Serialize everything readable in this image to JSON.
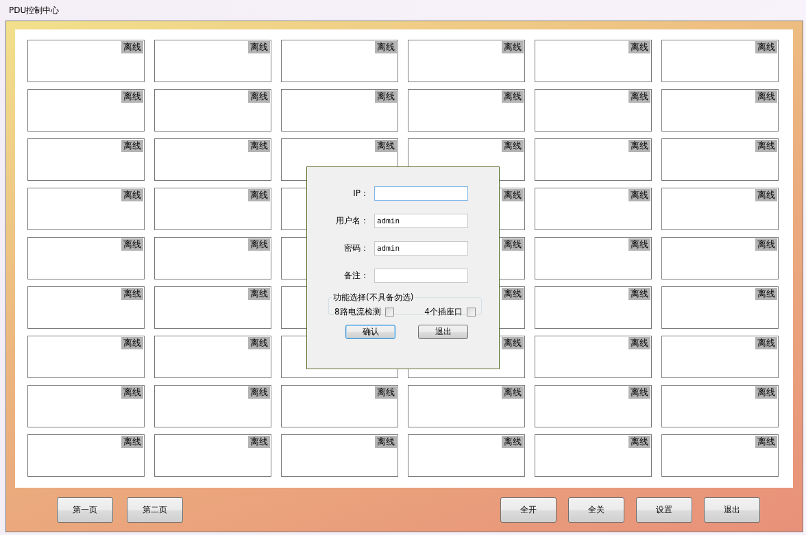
{
  "window": {
    "title": "PDU控制中心"
  },
  "grid": {
    "rows": [
      {
        "cells": [
          "离线",
          "离线",
          "离线",
          "离线",
          "离线",
          "离线"
        ]
      },
      {
        "cells": [
          "离线",
          "离线",
          "离线",
          "离线",
          "离线",
          "离线"
        ]
      },
      {
        "cells": [
          "离线",
          "离线",
          "离线",
          "离线",
          "离线",
          "离线"
        ]
      },
      {
        "cells": [
          "离线",
          "离线",
          null,
          "离线",
          "离线",
          "离线"
        ]
      },
      {
        "cells": [
          "离线",
          "离线",
          null,
          "离线",
          "离线",
          "离线"
        ]
      },
      {
        "cells": [
          "离线",
          "离线",
          null,
          "离线",
          "离线",
          "离线"
        ]
      },
      {
        "cells": [
          "离线",
          "离线",
          null,
          "离线",
          "离线",
          "离线"
        ]
      },
      {
        "cells": [
          "离线",
          "离线",
          "离线",
          "离线",
          "离线",
          "离线"
        ]
      },
      {
        "cells": [
          "离线",
          "离线",
          "离线",
          "离线",
          "离线",
          "离线"
        ]
      }
    ]
  },
  "dialog": {
    "fields": [
      {
        "label": "IP：",
        "focused": true
      },
      {
        "label": "用户名：",
        "value": "admin",
        "focused": false
      },
      {
        "label": "密码：",
        "value": "admin",
        "focused": false
      },
      {
        "label": "备注：",
        "focused": false
      }
    ],
    "group": {
      "title": "功能选择(不具备勿选)",
      "options": [
        {
          "label": "8路电流检测",
          "checked": false
        },
        {
          "label": "4个插座口",
          "checked": false
        }
      ]
    },
    "buttons": [
      {
        "label": "确认",
        "default": true
      },
      {
        "label": "退出",
        "default": false
      }
    ]
  },
  "footer": {
    "left_buttons": [
      "第一页",
      "第二页"
    ],
    "right_buttons": [
      "全开",
      "全关",
      "设置",
      "退出"
    ]
  }
}
